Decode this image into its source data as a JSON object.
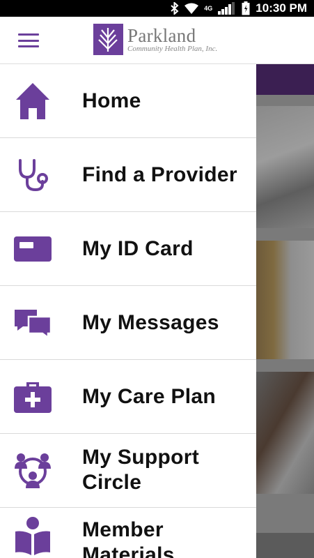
{
  "status_bar": {
    "time": "10:30 PM",
    "network": "4G",
    "icons": [
      "bluetooth-icon",
      "wifi-icon",
      "network-4g-icon",
      "signal-icon",
      "battery-icon"
    ]
  },
  "header": {
    "logo_name": "Parkland",
    "logo_subtitle": "Community Health Plan, Inc.",
    "menu_icon": "hamburger-icon"
  },
  "menu": {
    "items": [
      {
        "label": "Home",
        "icon": "home-icon"
      },
      {
        "label": "Find a Provider",
        "icon": "stethoscope-icon"
      },
      {
        "label": "My ID Card",
        "icon": "id-card-icon"
      },
      {
        "label": "My Messages",
        "icon": "messages-icon"
      },
      {
        "label": "My Care Plan",
        "icon": "medical-kit-icon"
      },
      {
        "label_line1": "My Support",
        "label_line2": "Circle",
        "icon": "support-circle-icon"
      },
      {
        "label_line1": "Member",
        "label_line2": "Materials",
        "icon": "book-reader-icon"
      }
    ]
  },
  "colors": {
    "brand_purple": "#6b3f9b",
    "status_bar": "#000000"
  }
}
